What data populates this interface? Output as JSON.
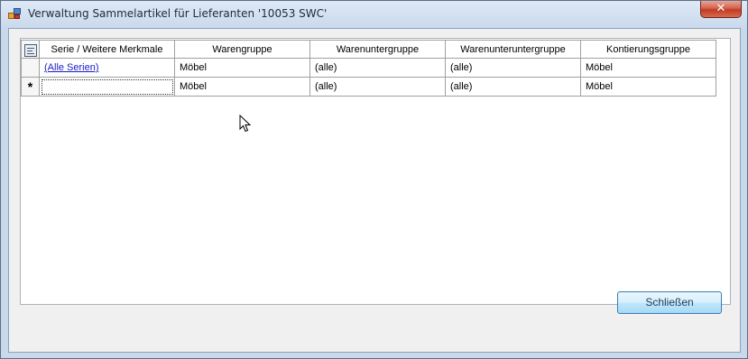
{
  "window": {
    "title": "Verwaltung Sammelartikel für Lieferanten '10053 SWC'",
    "close_glyph": "✕",
    "icon": "app-icon"
  },
  "grid": {
    "columns": [
      "Serie / Weitere Merkmale",
      "Warengruppe",
      "Warenuntergruppe",
      "Warenunteruntergruppe",
      "Kontierungsgruppe"
    ],
    "rows": [
      {
        "marker": "",
        "serie": "(Alle Serien)",
        "warengruppe": "Möbel",
        "warenuntergruppe": "(alle)",
        "warenunteruntergruppe": "(alle)",
        "kontierungsgruppe": "Möbel"
      },
      {
        "marker": "*",
        "serie": "",
        "warengruppe": "Möbel",
        "warenuntergruppe": "(alle)",
        "warenunteruntergruppe": "(alle)",
        "kontierungsgruppe": "Möbel"
      }
    ]
  },
  "buttons": {
    "close_label": "Schließen"
  },
  "colors": {
    "link": "#1a1ac8",
    "close_button_red": "#c23a22",
    "button_border": "#3c7fb1"
  }
}
